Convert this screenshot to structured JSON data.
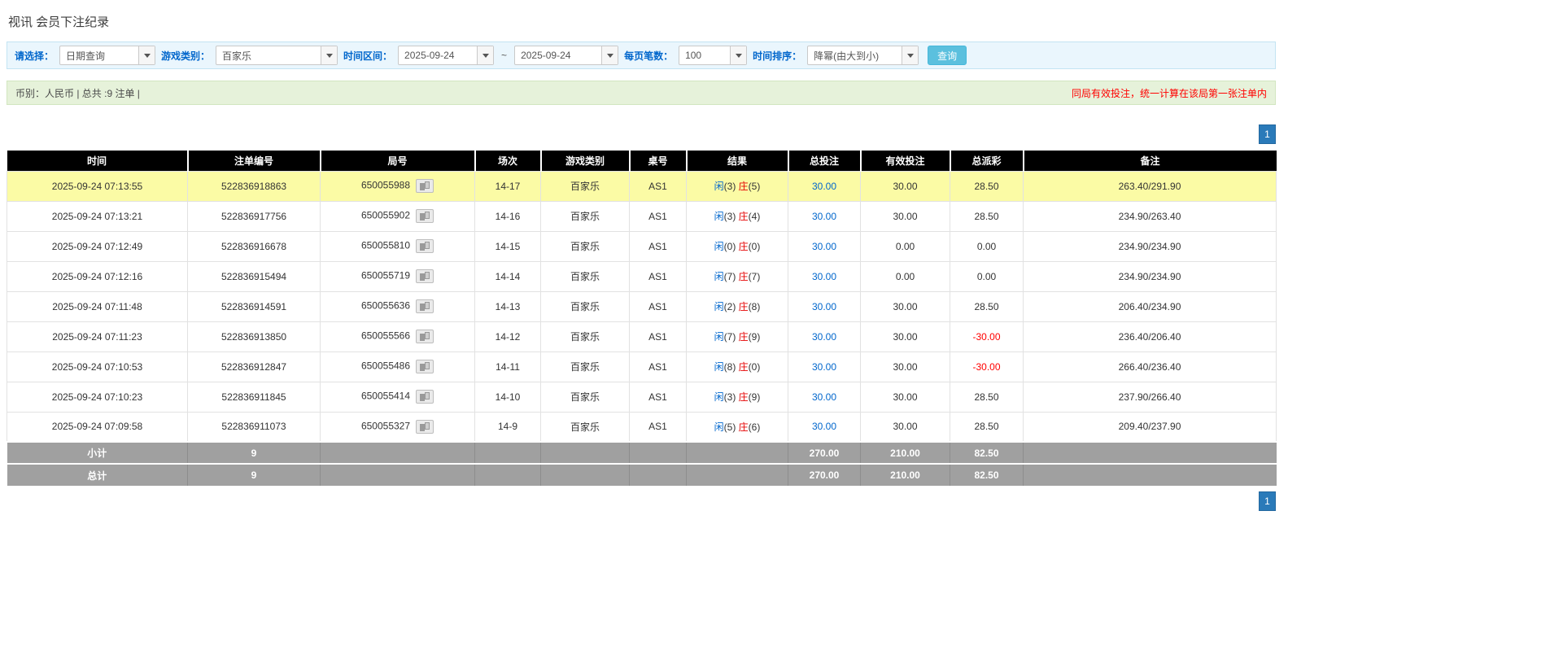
{
  "page": {
    "title": "视讯 会员下注纪录"
  },
  "filters": {
    "select_label": "请选择：",
    "select_value": "日期查询",
    "game_type_label": "游戏类别：",
    "game_type_value": "百家乐",
    "date_range_label": "时间区间：",
    "date_from": "2025-09-24",
    "range_separator": "~",
    "date_to": "2025-09-24",
    "page_size_label": "每页笔数：",
    "page_size_value": "100",
    "sort_label": "时间排序：",
    "sort_value": "降幂(由大到小)",
    "search_button": "查询"
  },
  "summary": {
    "left": "币别：人民币 | 总共 :9 注单 |",
    "right": "同局有效投注，统一计算在该局第一张注单内"
  },
  "pagination": {
    "page": "1"
  },
  "table": {
    "headers": [
      "时间",
      "注单编号",
      "局号",
      "场次",
      "游戏类别",
      "桌号",
      "结果",
      "总投注",
      "有效投注",
      "总派彩",
      "备注"
    ],
    "rows": [
      {
        "time": "2025-09-24 07:13:55",
        "bet_id": "522836918863",
        "round_no": "650055988",
        "session": "14-17",
        "game": "百家乐",
        "table_no": "AS1",
        "result": {
          "player": "闲",
          "player_n": "(3)",
          "banker": "庄",
          "banker_n": "(5)"
        },
        "total_bet": "30.00",
        "valid_bet": "30.00",
        "payout": "28.50",
        "note": "263.40/291.90",
        "highlight": true
      },
      {
        "time": "2025-09-24 07:13:21",
        "bet_id": "522836917756",
        "round_no": "650055902",
        "session": "14-16",
        "game": "百家乐",
        "table_no": "AS1",
        "result": {
          "player": "闲",
          "player_n": "(3)",
          "banker": "庄",
          "banker_n": "(4)"
        },
        "total_bet": "30.00",
        "valid_bet": "30.00",
        "payout": "28.50",
        "note": "234.90/263.40",
        "highlight": false
      },
      {
        "time": "2025-09-24 07:12:49",
        "bet_id": "522836916678",
        "round_no": "650055810",
        "session": "14-15",
        "game": "百家乐",
        "table_no": "AS1",
        "result": {
          "player": "闲",
          "player_n": "(0)",
          "banker": "庄",
          "banker_n": "(0)"
        },
        "total_bet": "30.00",
        "valid_bet": "0.00",
        "payout": "0.00",
        "note": "234.90/234.90",
        "highlight": false
      },
      {
        "time": "2025-09-24 07:12:16",
        "bet_id": "522836915494",
        "round_no": "650055719",
        "session": "14-14",
        "game": "百家乐",
        "table_no": "AS1",
        "result": {
          "player": "闲",
          "player_n": "(7)",
          "banker": "庄",
          "banker_n": "(7)"
        },
        "total_bet": "30.00",
        "valid_bet": "0.00",
        "payout": "0.00",
        "note": "234.90/234.90",
        "highlight": false
      },
      {
        "time": "2025-09-24 07:11:48",
        "bet_id": "522836914591",
        "round_no": "650055636",
        "session": "14-13",
        "game": "百家乐",
        "table_no": "AS1",
        "result": {
          "player": "闲",
          "player_n": "(2)",
          "banker": "庄",
          "banker_n": "(8)"
        },
        "total_bet": "30.00",
        "valid_bet": "30.00",
        "payout": "28.50",
        "note": "206.40/234.90",
        "highlight": false
      },
      {
        "time": "2025-09-24 07:11:23",
        "bet_id": "522836913850",
        "round_no": "650055566",
        "session": "14-12",
        "game": "百家乐",
        "table_no": "AS1",
        "result": {
          "player": "闲",
          "player_n": "(7)",
          "banker": "庄",
          "banker_n": "(9)"
        },
        "total_bet": "30.00",
        "valid_bet": "30.00",
        "payout": "-30.00",
        "note": "236.40/206.40",
        "highlight": false
      },
      {
        "time": "2025-09-24 07:10:53",
        "bet_id": "522836912847",
        "round_no": "650055486",
        "session": "14-11",
        "game": "百家乐",
        "table_no": "AS1",
        "result": {
          "player": "闲",
          "player_n": "(8)",
          "banker": "庄",
          "banker_n": "(0)"
        },
        "total_bet": "30.00",
        "valid_bet": "30.00",
        "payout": "-30.00",
        "note": "266.40/236.40",
        "highlight": false
      },
      {
        "time": "2025-09-24 07:10:23",
        "bet_id": "522836911845",
        "round_no": "650055414",
        "session": "14-10",
        "game": "百家乐",
        "table_no": "AS1",
        "result": {
          "player": "闲",
          "player_n": "(3)",
          "banker": "庄",
          "banker_n": "(9)"
        },
        "total_bet": "30.00",
        "valid_bet": "30.00",
        "payout": "28.50",
        "note": "237.90/266.40",
        "highlight": false
      },
      {
        "time": "2025-09-24 07:09:58",
        "bet_id": "522836911073",
        "round_no": "650055327",
        "session": "14-9",
        "game": "百家乐",
        "table_no": "AS1",
        "result": {
          "player": "闲",
          "player_n": "(5)",
          "banker": "庄",
          "banker_n": "(6)"
        },
        "total_bet": "30.00",
        "valid_bet": "30.00",
        "payout": "28.50",
        "note": "209.40/237.90",
        "highlight": false
      }
    ],
    "subtotal": {
      "label": "小计",
      "count": "9",
      "total_bet": "270.00",
      "valid_bet": "210.00",
      "payout": "82.50"
    },
    "total": {
      "label": "总计",
      "count": "9",
      "total_bet": "270.00",
      "valid_bet": "210.00",
      "payout": "82.50"
    }
  },
  "colors": {
    "accent_blue": "#0066cc",
    "banker_red": "#e60000",
    "negative_red": "#ff0000",
    "highlight_yellow": "#fbfba5",
    "header_black": "#000000",
    "footer_gray": "#a0a0a0",
    "pager_blue": "#2a7ab9"
  }
}
